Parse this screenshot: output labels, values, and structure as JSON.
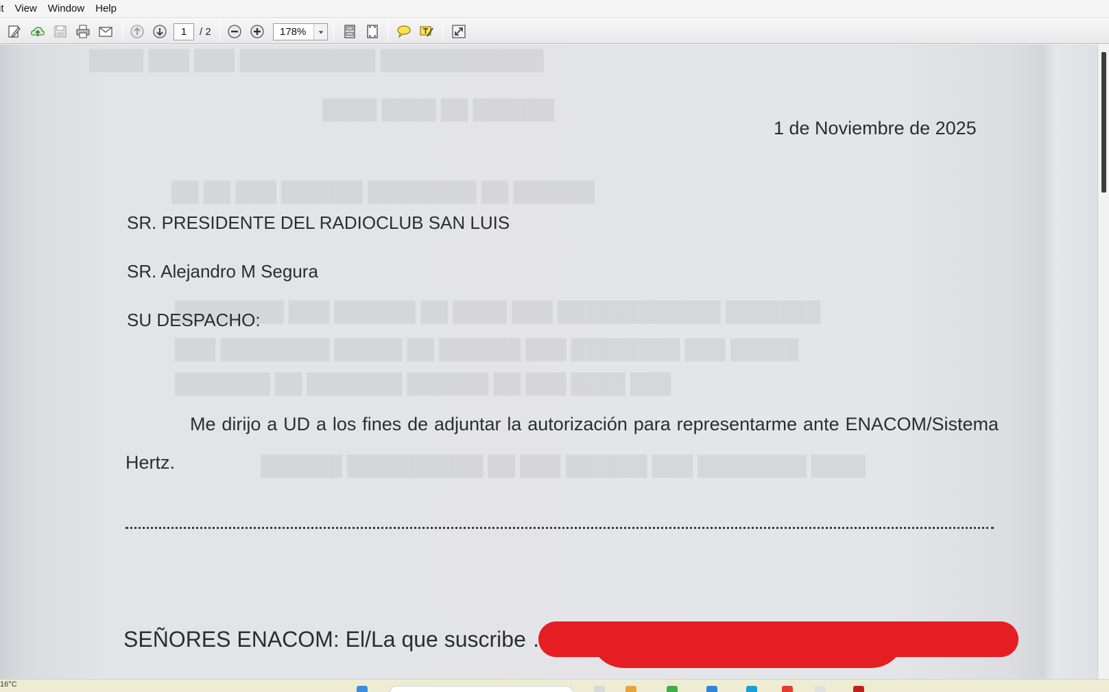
{
  "menu": [
    "it",
    "View",
    "Window",
    "Help"
  ],
  "toolbar": {
    "current_page": "1",
    "page_total": "/ 2",
    "zoom": "178%",
    "icons": [
      "edit-icon",
      "upload-icon",
      "save-icon",
      "print-icon",
      "email-icon",
      "previous-page-icon",
      "next-page-icon",
      "zoom-out-icon",
      "zoom-in-icon",
      "fit-page-icon",
      "fit-width-icon",
      "comment-icon",
      "highlight-text-icon",
      "fullscreen-icon"
    ]
  },
  "document": {
    "date": "1 de Noviembre  de 2025",
    "recipient_line1": "SR. PRESIDENTE DEL RADIOCLUB SAN LUIS",
    "recipient_line2": "SR. Alejandro M Segura",
    "recipient_line3": "SU DESPACHO:",
    "paragraph": "Me dirijo a UD a los fines de adjuntar la autorización para representarme ante ENACOM/Sistema Hertz.",
    "senores_line": "SEÑORES ENACOM: El/La que suscribe …."
  },
  "taskbar": {
    "temperature": "16°C"
  },
  "colors": {
    "redaction": "#e51e24",
    "document_text": "#2b2d31",
    "scroll_thumb": "#3c3c3c"
  }
}
